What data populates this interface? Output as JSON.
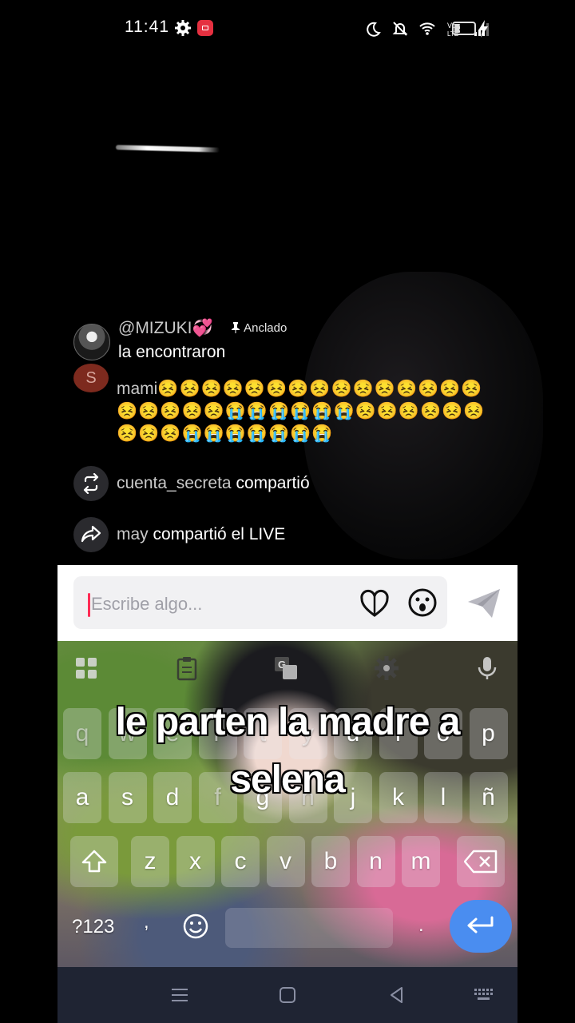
{
  "status_bar": {
    "time": "11:41",
    "battery": "29",
    "battery_level": 0.29,
    "icons": [
      "gear-icon",
      "screen-record-icon",
      "moon-icon",
      "mute-icon",
      "wifi-icon",
      "volte-icon",
      "signal-icon",
      "battery-icon",
      "charging-icon"
    ]
  },
  "chat": {
    "pinned": {
      "username": "@MIZUKI💞",
      "pin_label": "Anclado",
      "message": "la encontraron"
    },
    "emoji_comment": {
      "username": "mami",
      "avatar_letter": "S",
      "emojis": "😣😣😣😣😣😣😣😣😣😣😣😣😣😣😣😣😣😣😣😣😭😭😭😭😭😭😣😣😣😣😣😣😣😣😣😭😭😭😭😭😭😭"
    },
    "share1": {
      "username": "cuenta_secreta",
      "action": "compartió"
    },
    "share2": {
      "username": "may",
      "action": "compartió el LIVE"
    }
  },
  "input": {
    "placeholder": "Escribe algo..."
  },
  "keyboard": {
    "row1": [
      "q",
      "w",
      "e",
      "r",
      "t",
      "y",
      "u",
      "i",
      "o",
      "p"
    ],
    "row2": [
      "a",
      "s",
      "d",
      "f",
      "g",
      "h",
      "j",
      "k",
      "l",
      "ñ"
    ],
    "row3": [
      "z",
      "x",
      "c",
      "v",
      "b",
      "n",
      "m"
    ],
    "symbols_label": "?123",
    "comma": ",",
    "period": "."
  },
  "caption": {
    "line1": "le parten la madre a",
    "line2": "selena"
  },
  "colors": {
    "accent_red": "#fe2c55",
    "enter_blue": "#4a8df0",
    "navbar": "#1f2433"
  }
}
